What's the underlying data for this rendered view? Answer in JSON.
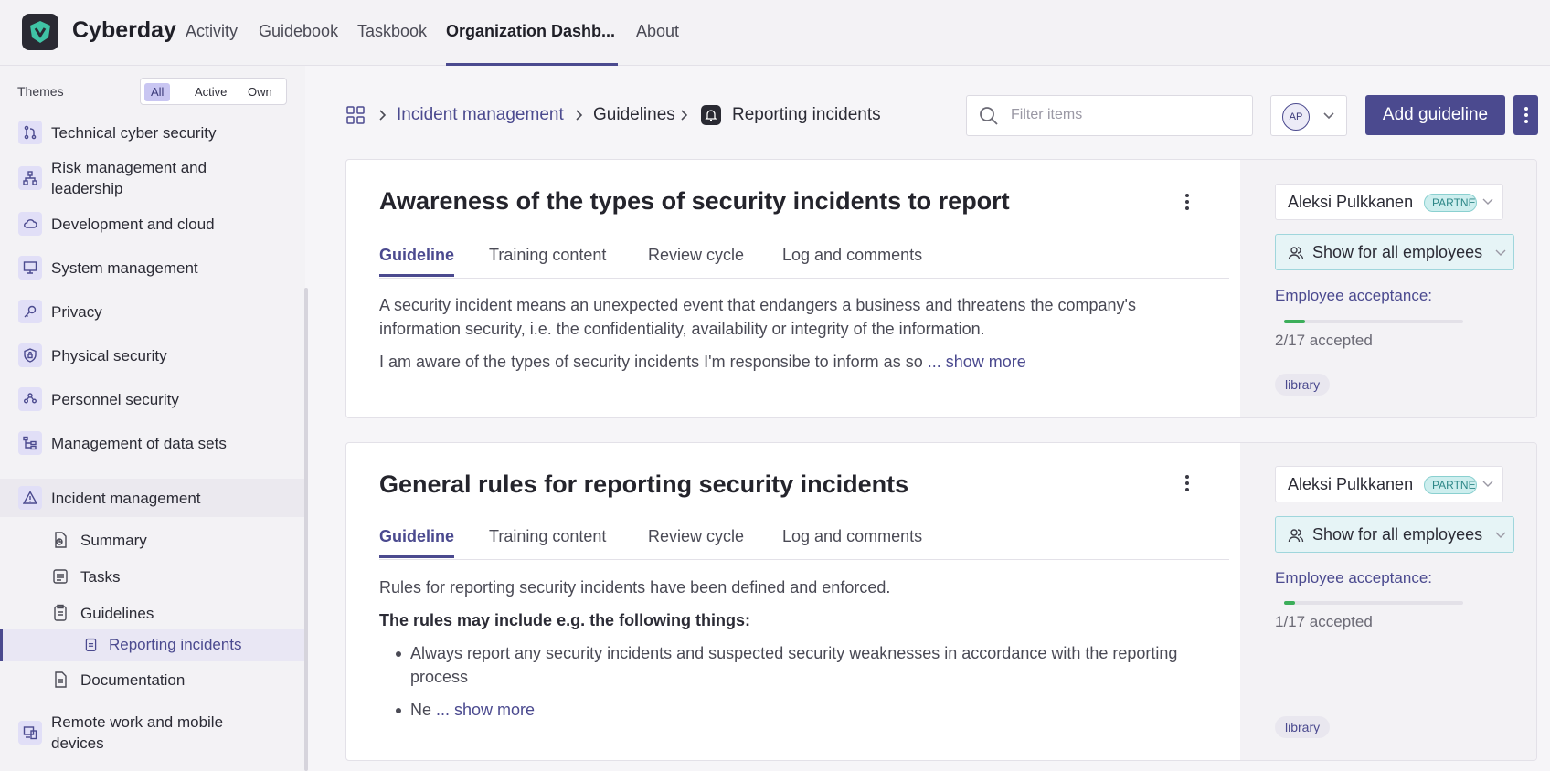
{
  "app": {
    "name": "Cyberday",
    "nav": [
      "Activity",
      "Guidebook",
      "Taskbook",
      "Organization Dashb...",
      "About"
    ],
    "active_nav": "Organization Dashb..."
  },
  "sidebar": {
    "themes_label": "Themes",
    "filters": [
      "All",
      "Active",
      "Own"
    ],
    "active_filter": "All",
    "themes": [
      {
        "label": "Technical cyber security",
        "icon": "git-branch-icon"
      },
      {
        "label": "Risk management and leadership",
        "icon": "org-chart-icon"
      },
      {
        "label": "Development and cloud",
        "icon": "cloud-icon"
      },
      {
        "label": "System management",
        "icon": "monitor-icon"
      },
      {
        "label": "Privacy",
        "icon": "key-icon"
      },
      {
        "label": "Physical security",
        "icon": "shield-lock-icon"
      },
      {
        "label": "Personnel security",
        "icon": "people-icon"
      },
      {
        "label": "Management of data sets",
        "icon": "data-tree-icon"
      },
      {
        "label": "Incident management",
        "icon": "warning-icon"
      },
      {
        "label": "Remote work and mobile devices",
        "icon": "devices-icon"
      }
    ],
    "sub_items": [
      "Summary",
      "Tasks",
      "Guidelines",
      "Documentation"
    ],
    "current_item": "Reporting incidents"
  },
  "breadcrumb": {
    "root_icon": "grid-icon",
    "items": [
      "Incident management",
      "Guidelines",
      "Reporting incidents"
    ]
  },
  "search": {
    "placeholder": "Filter items",
    "value": ""
  },
  "user": {
    "initials": "AP"
  },
  "add_button_label": "Add guideline",
  "tab_labels": [
    "Guideline",
    "Training content",
    "Review cycle",
    "Log and comments"
  ],
  "cards": [
    {
      "title": "Awareness of the types of security incidents to report",
      "paragraph1": "A security incident means an unexpected event that endangers a business and threatens the company's information security, i.e. the confidentiality, availability or integrity of the information.",
      "paragraph2": "I am aware of the types of security incidents I'm responsibe to inform as so",
      "show_more": "... show more",
      "owner": "Aleksi Pulkkanen",
      "owner_badge": "PARTNER",
      "visibility": "Show for all employees",
      "acceptance_label": "Employee acceptance:",
      "accepted": 2,
      "total": 17,
      "accepted_text": "2/17 accepted",
      "tag": "library"
    },
    {
      "title": "General rules for reporting security incidents",
      "paragraph1": "Rules for reporting security incidents have been defined and enforced.",
      "bold_line": "The rules may include e.g. the following things:",
      "bullet1": "Always report any security incidents and suspected security weaknesses in accordance with the reporting process",
      "bullet2": "Ne",
      "show_more": "... show more",
      "owner": "Aleksi Pulkkanen",
      "owner_badge": "PARTNER",
      "visibility": "Show for all employees",
      "acceptance_label": "Employee acceptance:",
      "accepted": 1,
      "total": 17,
      "accepted_text": "1/17 accepted",
      "tag": "library"
    }
  ],
  "colors": {
    "accent": "#4b4a8f",
    "progress": "#3cae5a",
    "badge": "#2d8787"
  }
}
